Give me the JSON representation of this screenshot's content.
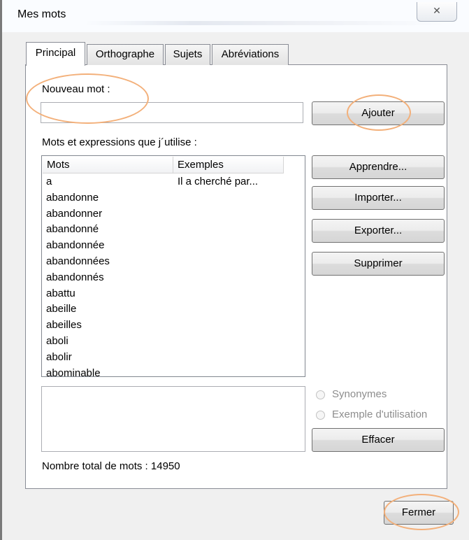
{
  "window": {
    "title": "Mes mots",
    "close_glyph": "✕"
  },
  "tabs": [
    {
      "label": "Principal",
      "active": true
    },
    {
      "label": "Orthographe",
      "active": false
    },
    {
      "label": "Sujets",
      "active": false
    },
    {
      "label": "Abréviations",
      "active": false
    }
  ],
  "new_word": {
    "label": "Nouveau mot :",
    "value": "",
    "add_button": "Ajouter"
  },
  "word_list": {
    "label": "Mots et expressions que j´utilise :",
    "columns": [
      "Mots",
      "Exemples"
    ],
    "rows": [
      {
        "word": "a",
        "example": "Il a cherché par..."
      },
      {
        "word": "abandonne",
        "example": ""
      },
      {
        "word": "abandonner",
        "example": ""
      },
      {
        "word": "abandonné",
        "example": ""
      },
      {
        "word": "abandonnée",
        "example": ""
      },
      {
        "word": "abandonnées",
        "example": ""
      },
      {
        "word": "abandonnés",
        "example": ""
      },
      {
        "word": "abattu",
        "example": ""
      },
      {
        "word": "abeille",
        "example": ""
      },
      {
        "word": "abeilles",
        "example": ""
      },
      {
        "word": "aboli",
        "example": ""
      },
      {
        "word": "abolir",
        "example": ""
      },
      {
        "word": "abominable",
        "example": ""
      }
    ]
  },
  "side_buttons": {
    "learn": "Apprendre...",
    "import": "Importer...",
    "export": "Exporter...",
    "delete": "Supprimer"
  },
  "options": {
    "synonyms": "Synonymes",
    "usage_example": "Exemple d'utilisation",
    "clear_button": "Effacer"
  },
  "status": {
    "total_words": "Nombre total de mots : 14950"
  },
  "footer": {
    "close_button": "Fermer"
  },
  "colors": {
    "highlight": "#f3b07a",
    "disabled_text": "#8d8d8d"
  },
  "icons": {
    "close": "close-icon",
    "scroll_up": "arrow-up-icon",
    "scroll_down": "arrow-down-icon"
  }
}
